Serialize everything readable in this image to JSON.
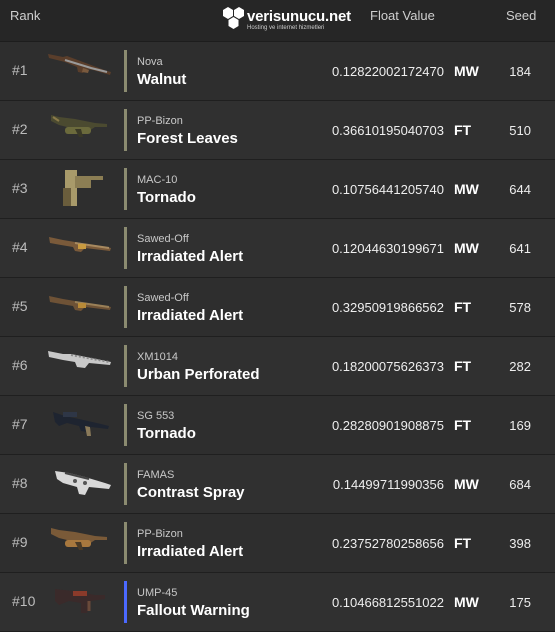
{
  "header": {
    "rank_label": "Rank",
    "float_label": "Float Value",
    "seed_label": "Seed",
    "logo_name": "verisunucu.net",
    "logo_tagline": "Hosting ve internet hizmetleri"
  },
  "rows": [
    {
      "rank": "#1",
      "weapon": "Nova",
      "skin": "Walnut",
      "float": "0.12822002172470",
      "wear": "MW",
      "seed": "184",
      "icon": "nova-shotgun-icon"
    },
    {
      "rank": "#2",
      "weapon": "PP-Bizon",
      "skin": "Forest Leaves",
      "float": "0.36610195040703",
      "wear": "FT",
      "seed": "510",
      "icon": "ppbizon-smg-icon"
    },
    {
      "rank": "#3",
      "weapon": "MAC-10",
      "skin": "Tornado",
      "float": "0.10756441205740",
      "wear": "MW",
      "seed": "644",
      "icon": "mac10-smg-icon"
    },
    {
      "rank": "#4",
      "weapon": "Sawed-Off",
      "skin": "Irradiated Alert",
      "float": "0.12044630199671",
      "wear": "MW",
      "seed": "641",
      "icon": "sawedoff-shotgun-icon"
    },
    {
      "rank": "#5",
      "weapon": "Sawed-Off",
      "skin": "Irradiated Alert",
      "float": "0.32950919866562",
      "wear": "FT",
      "seed": "578",
      "icon": "sawedoff-shotgun-icon"
    },
    {
      "rank": "#6",
      "weapon": "XM1014",
      "skin": "Urban Perforated",
      "float": "0.18200075626373",
      "wear": "FT",
      "seed": "282",
      "icon": "xm1014-shotgun-icon"
    },
    {
      "rank": "#7",
      "weapon": "SG 553",
      "skin": "Tornado",
      "float": "0.28280901908875",
      "wear": "FT",
      "seed": "169",
      "icon": "sg553-rifle-icon"
    },
    {
      "rank": "#8",
      "weapon": "FAMAS",
      "skin": "Contrast Spray",
      "float": "0.14499711990356",
      "wear": "MW",
      "seed": "684",
      "icon": "famas-rifle-icon"
    },
    {
      "rank": "#9",
      "weapon": "PP-Bizon",
      "skin": "Irradiated Alert",
      "float": "0.23752780258656",
      "wear": "FT",
      "seed": "398",
      "icon": "ppbizon-smg-icon"
    },
    {
      "rank": "#10",
      "weapon": "UMP-45",
      "skin": "Fallout Warning",
      "float": "0.10466812551022",
      "wear": "MW",
      "seed": "175",
      "icon": "ump45-smg-icon"
    }
  ],
  "colors": {
    "background": "#2c2c2c",
    "header_bg": "#262626",
    "consumer_grade": "#8b8b70",
    "milspec_grade": "#4b69ff"
  }
}
